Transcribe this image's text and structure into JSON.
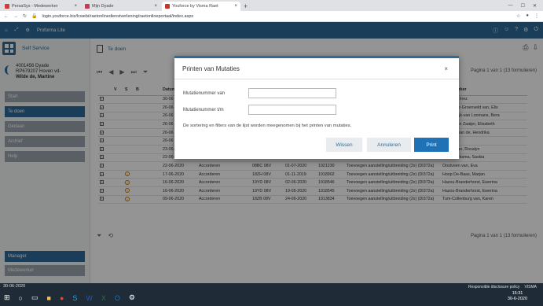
{
  "browser": {
    "tabs": [
      {
        "label": "PersaSys - Medewerker",
        "color": "#d23b3b"
      },
      {
        "label": "Mijn Dyade",
        "color": "#c43b57"
      },
      {
        "label": "Youforce by Visma Raet",
        "color": "#c0392b"
      }
    ],
    "url": "login.youforce.biz/lcwebi/raetonlinedienstverlening/raetonlineportaal/index.aspx"
  },
  "app": {
    "header_title": "Proforma Lite",
    "self_service": "Self Service",
    "user_line1": "4001456 Dyade",
    "user_line2": "RP679207 Hoven vd-",
    "user_line3": "Wilde de, Martine",
    "nav": [
      "Start",
      "Te doen",
      "Gedaan",
      "Archief",
      "Help"
    ],
    "nav_bottom": [
      "Manager",
      "Medewerker"
    ],
    "page_title": "Te doen",
    "pager": "Pagina 1 van 1 (13 formulieren)"
  },
  "table": {
    "headers": [
      "",
      "V",
      "S",
      "B",
      "Datum",
      "",
      "",
      "",
      "",
      "",
      "Medewerker"
    ],
    "rows": [
      [
        "30-06",
        "",
        "",
        "",
        "",
        "",
        "Bolmika, Inez"
      ],
      [
        "26-06",
        "",
        "",
        "",
        "",
        "",
        "Toxelager-Groenveld van, Elis"
      ],
      [
        "26-06",
        "",
        "",
        "",
        "",
        "",
        "Blitterswijk-van Loomans, Bera"
      ],
      [
        "26-06",
        "",
        "",
        "",
        "",
        "",
        "Doorn van Zaaijer, Elisabeth"
      ],
      [
        "26-06",
        "",
        "",
        "",
        "",
        "",
        "Werken van de, Hendrika"
      ],
      [
        "26-06",
        "",
        "",
        "",
        "",
        "",
        "Heij, Berl"
      ],
      [
        "23-06-2020",
        "Accorderen",
        "20CX 08V",
        "23-06-2020",
        "1922229",
        "Toevoegen aanstelling/uitbreiding (2x) (DI372a)",
        "Putten van, Rosalyn"
      ],
      [
        "22-06-2020",
        "Accorderen",
        "20DX 08V",
        "15-06-2020",
        "1917364",
        "Toevoegen aanstelling/uitbreiding (2x) (DI372a)",
        "Rook-Turksma, Saskia"
      ],
      [
        "22-06-2020",
        "Accorderen",
        "08BC 08V",
        "01-07-2020",
        "1921230",
        "Toevoegen aanstelling/uitbreiding (2x) (DI372a)",
        "Oostveen van, Eva"
      ],
      [
        "17-06-2020",
        "Accorderen",
        "18ZH 08V",
        "01-11-2019",
        "1918902",
        "Toevoegen aanstelling/uitbreiding (2x) (DI372a)",
        "Hoop De-Baas, Marjan"
      ],
      [
        "16-06-2020",
        "Accorderen",
        "19YD 08V",
        "02-06-2020",
        "1918546",
        "Toevoegen aanstelling/uitbreiding (2x) (DI372a)",
        "Hazou-Branderhorst, Ewerina"
      ],
      [
        "16-06-2020",
        "Accorderen",
        "19YD 08V",
        "19-05-2020",
        "1918545",
        "Toevoegen aanstelling/uitbreiding (2x) (DI372a)",
        "Hazou-Branderhorst, Ewerina"
      ],
      [
        "09-06-2020",
        "Accorderen",
        "18ZB 08V",
        "24-06-2020",
        "1913834",
        "Toevoegen aanstelling/uitbreiding (2x) (DI372a)",
        "Tum-Collenburg van, Karen"
      ]
    ],
    "warn_rows": [
      9,
      10,
      11,
      12
    ]
  },
  "modal": {
    "title": "Printen van Mutaties",
    "close": "×",
    "label_from": "Mutatienummer van",
    "label_to": "Mutatienummer t/m",
    "value_from": "",
    "value_to": "",
    "note": "De sortering en filters van de lijst worden meegenomen bij het printen van mutaties.",
    "btn_clear": "Wissen",
    "btn_cancel": "Annuleren",
    "btn_print": "Print"
  },
  "taskbar": {
    "date_left": "30-06-2020",
    "disclosure": "Responsible disclosure policy",
    "brand": "VISMA",
    "time": "16:31",
    "date": "30-6-2020"
  }
}
